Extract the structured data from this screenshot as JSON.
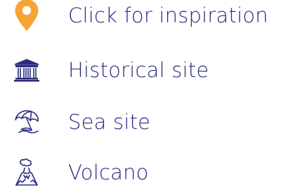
{
  "legend": {
    "items": [
      {
        "icon": "map-pin-icon",
        "label": "Click for inspiration",
        "color": "#f6a534"
      },
      {
        "icon": "temple-icon",
        "label": "Historical site",
        "color": "#2b2c7e"
      },
      {
        "icon": "beach-umbrella-icon",
        "label": "Sea site",
        "color": "#2b2c7e"
      },
      {
        "icon": "volcano-icon",
        "label": "Volcano",
        "color": "#2b2c7e"
      }
    ]
  }
}
